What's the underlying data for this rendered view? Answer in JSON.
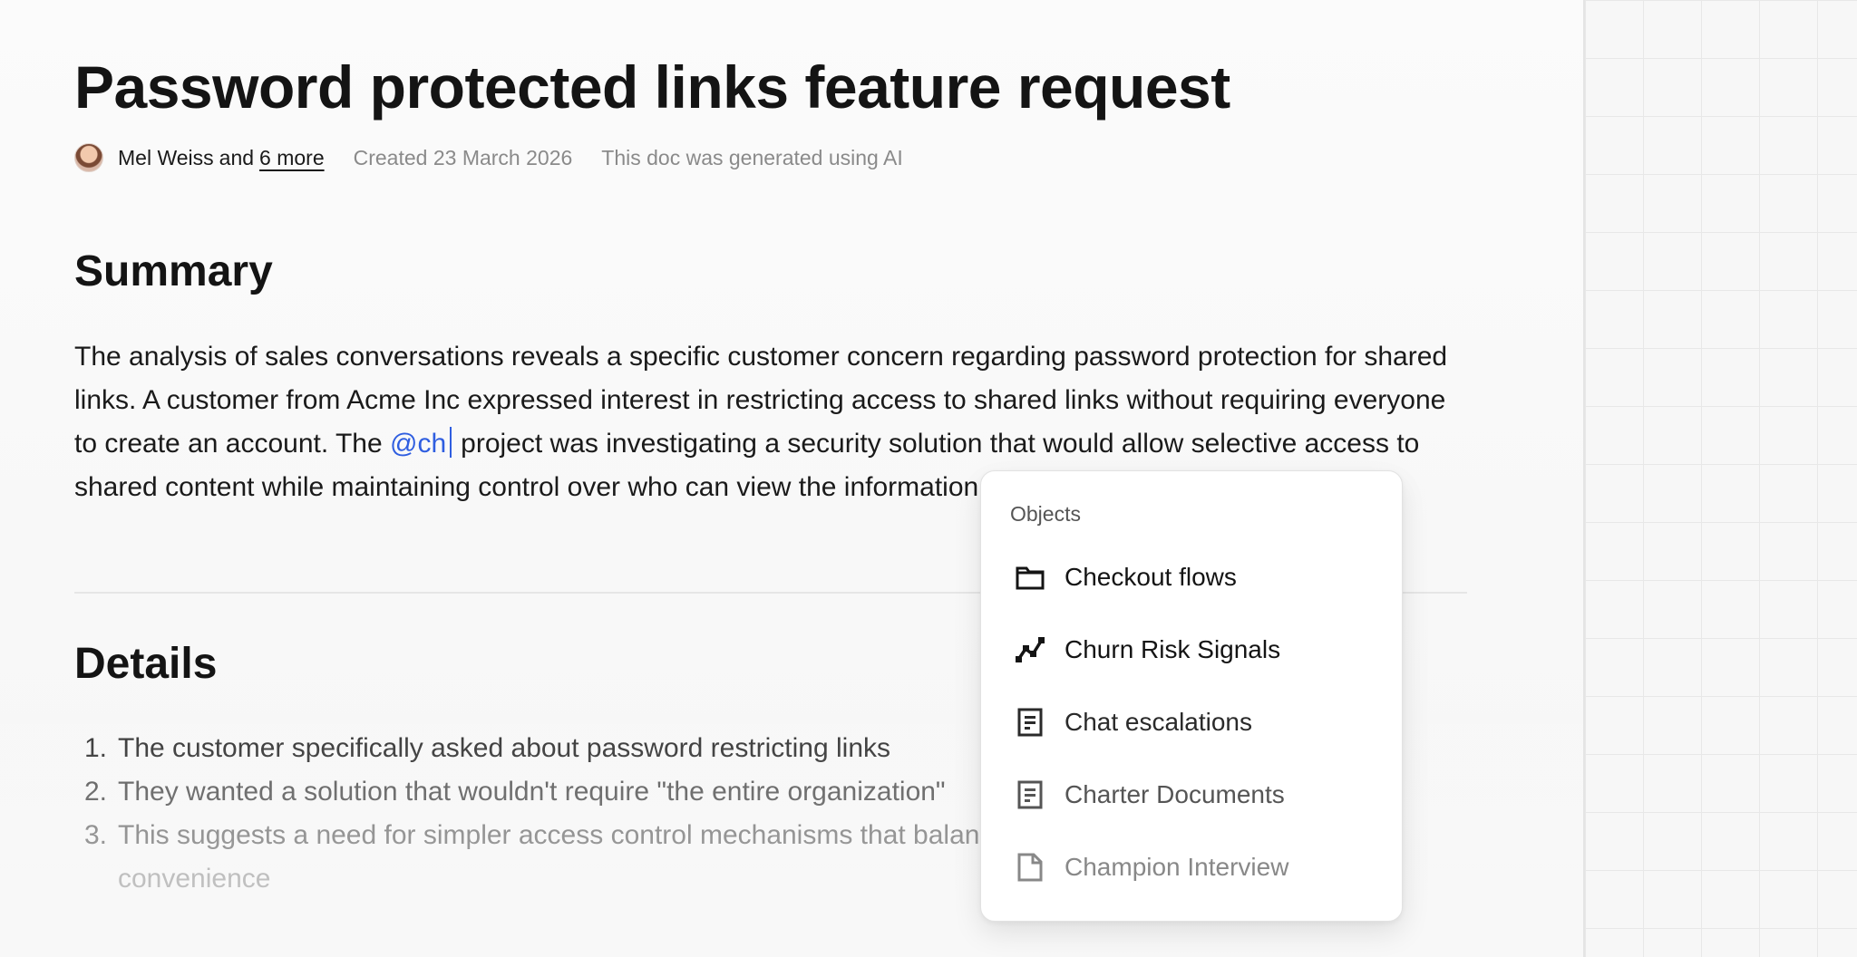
{
  "doc": {
    "title": "Password protected links feature request",
    "meta": {
      "author": "Mel Weiss",
      "and": "and",
      "more": "6 more",
      "created": "Created 23 March 2026",
      "ai_note": "This doc was generated using AI"
    },
    "summary_heading": "Summary",
    "summary_before": "The analysis of sales conversations reveals a specific customer concern regarding password protection for shared links. A customer from Acme Inc expressed interest in restricting access to shared links without requiring everyone to create an account. The ",
    "mention_text": "@ch",
    "summary_after": "project was investigating a security solution that would allow selective access to shared content while maintaining control over who can view the information.",
    "details_heading": "Details",
    "details": [
      {
        "num": "1.",
        "text": "The customer specifically asked about password restricting links"
      },
      {
        "num": "2.",
        "text": "They wanted a solution that wouldn't require \"the entire organization\""
      },
      {
        "num": "3.",
        "text": "This suggests a need for simpler access control mechanisms that balance security and",
        "cont": "convenience"
      }
    ]
  },
  "dropdown": {
    "heading": "Objects",
    "items": [
      {
        "label": "Checkout flows",
        "icon": "folder-icon"
      },
      {
        "label": "Churn Risk Signals",
        "icon": "trend-line-icon"
      },
      {
        "label": "Chat escalations",
        "icon": "document-icon"
      },
      {
        "label": "Charter Documents",
        "icon": "document-icon"
      },
      {
        "label": "Champion Interview",
        "icon": "file-icon"
      }
    ]
  }
}
